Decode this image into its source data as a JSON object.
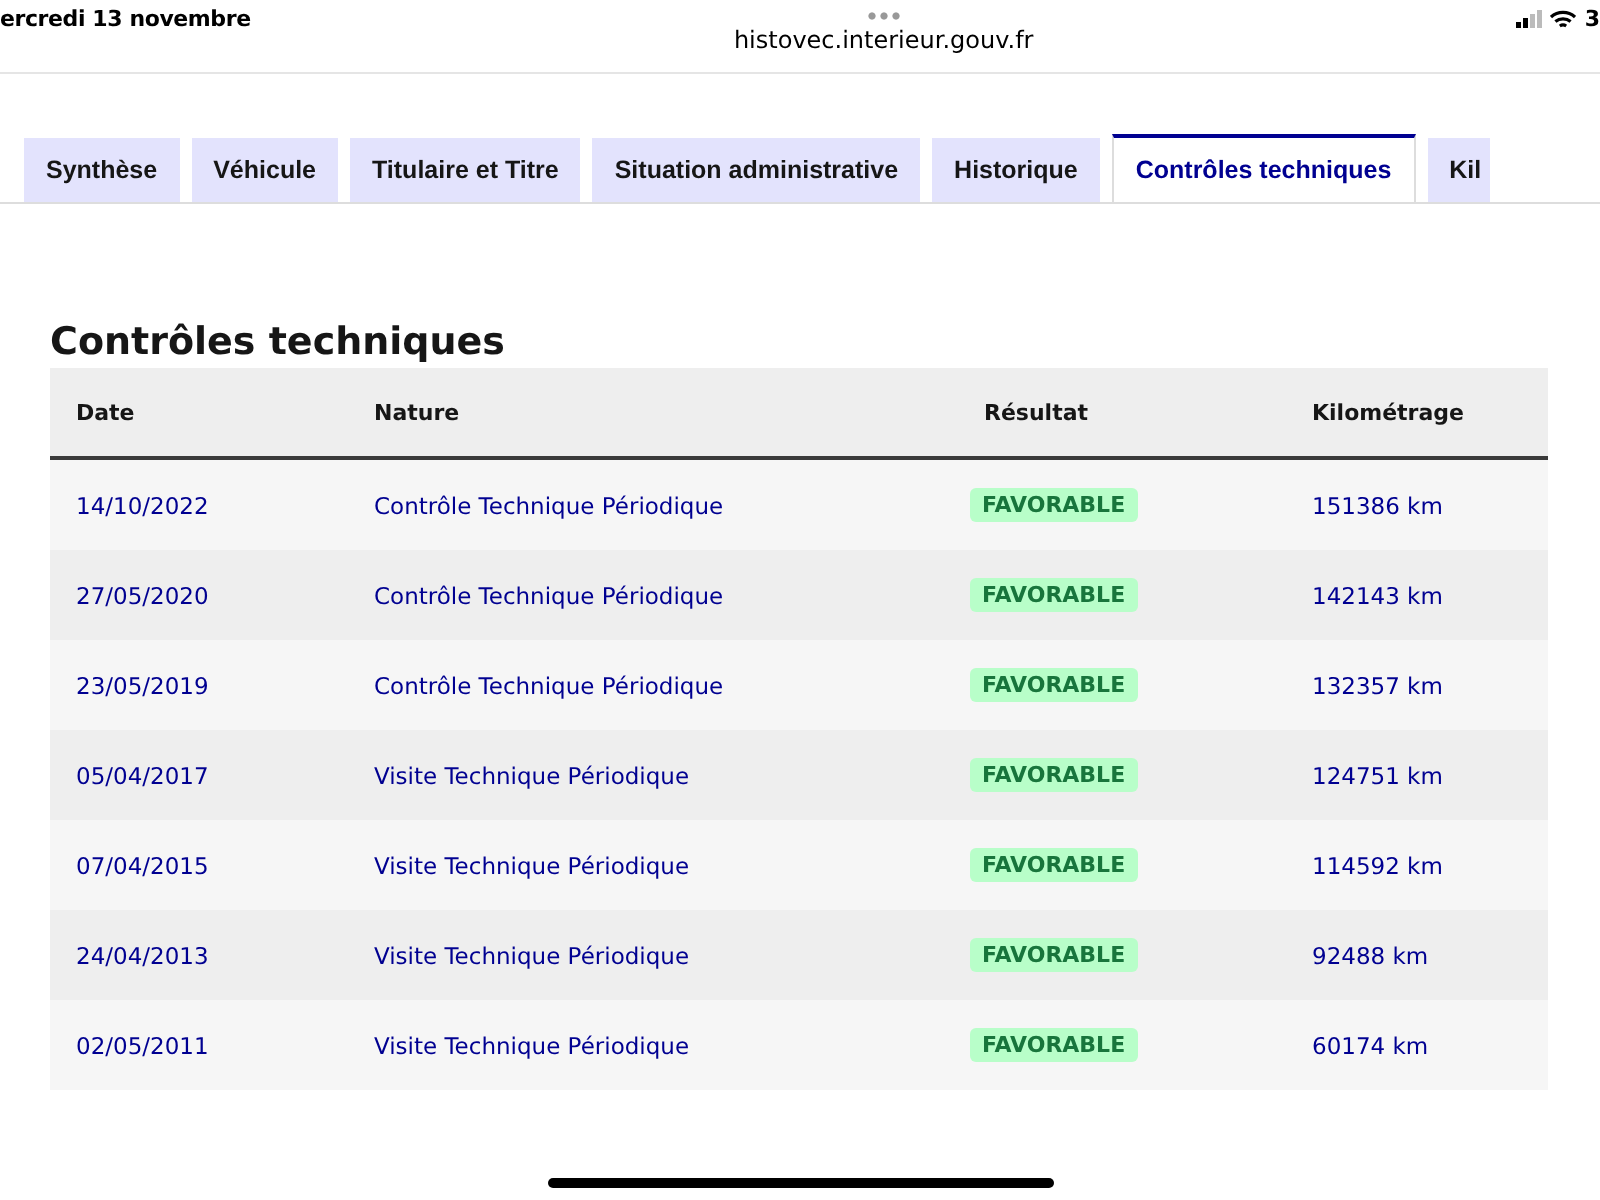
{
  "status_bar": {
    "date": "ercredi 13 novembre",
    "url": "histovec.interieur.gouv.fr",
    "battery": "3"
  },
  "tabs": [
    {
      "label": "Synthèse",
      "selected": false
    },
    {
      "label": "Véhicule",
      "selected": false
    },
    {
      "label": "Titulaire et Titre",
      "selected": false
    },
    {
      "label": "Situation administrative",
      "selected": false
    },
    {
      "label": "Historique",
      "selected": false
    },
    {
      "label": "Contrôles techniques",
      "selected": true
    },
    {
      "label": "Kil",
      "selected": false
    }
  ],
  "section": {
    "title": "Contrôles techniques"
  },
  "table": {
    "columns": [
      "Date",
      "Nature",
      "Résultat",
      "Kilométrage"
    ],
    "rows": [
      {
        "date": "14/10/2022",
        "nature": "Contrôle Technique Périodique",
        "result": "FAVORABLE",
        "mileage": "151386 km"
      },
      {
        "date": "27/05/2020",
        "nature": "Contrôle Technique Périodique",
        "result": "FAVORABLE",
        "mileage": "142143 km"
      },
      {
        "date": "23/05/2019",
        "nature": "Contrôle Technique Périodique",
        "result": "FAVORABLE",
        "mileage": "132357 km"
      },
      {
        "date": "05/04/2017",
        "nature": "Visite Technique Périodique",
        "result": "FAVORABLE",
        "mileage": "124751 km"
      },
      {
        "date": "07/04/2015",
        "nature": "Visite Technique Périodique",
        "result": "FAVORABLE",
        "mileage": "114592 km"
      },
      {
        "date": "24/04/2013",
        "nature": "Visite Technique Périodique",
        "result": "FAVORABLE",
        "mileage": "92488 km"
      },
      {
        "date": "02/05/2011",
        "nature": "Visite Technique Périodique",
        "result": "FAVORABLE",
        "mileage": "60174 km"
      }
    ]
  }
}
